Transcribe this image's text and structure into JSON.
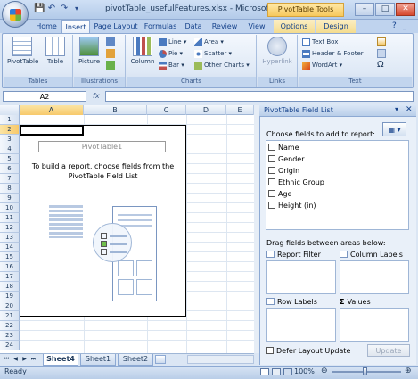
{
  "window": {
    "title": "pivotTable_usefulFeatures.xlsx - Microsoft Ex...",
    "context_title": "PivotTable Tools",
    "minimize": "–",
    "maximize": "□",
    "close": "✕"
  },
  "tabs": [
    "Home",
    "Insert",
    "Page Layout",
    "Formulas",
    "Data",
    "Review",
    "View",
    "Options",
    "Design"
  ],
  "ribbon": {
    "tables": {
      "label": "Tables",
      "pivot": "PivotTable",
      "table": "Table"
    },
    "illustrations": {
      "label": "Illustrations",
      "picture": "Picture"
    },
    "charts": {
      "label": "Charts",
      "column": "Column",
      "line": "Line",
      "pie": "Pie",
      "bar": "Bar",
      "area": "Area",
      "scatter": "Scatter",
      "other": "Other Charts"
    },
    "links": {
      "label": "Links",
      "hyperlink": "Hyperlink"
    },
    "text": {
      "label": "Text",
      "textbox": "Text Box",
      "header_footer": "Header & Footer",
      "wordart": "WordArt"
    }
  },
  "formula_bar": {
    "name_box": "A2",
    "fx": "fx",
    "value": ""
  },
  "grid": {
    "columns": [
      "A",
      "B",
      "C",
      "D",
      "E"
    ],
    "rows": [
      "1",
      "2",
      "3",
      "4",
      "5",
      "6",
      "7",
      "8",
      "9",
      "10",
      "11",
      "12",
      "13",
      "14",
      "15",
      "16",
      "17",
      "18",
      "19",
      "20",
      "21",
      "22",
      "23",
      "24"
    ],
    "pivot_name": "PivotTable1",
    "instruction_line1": "To build a report, choose fields from the",
    "instruction_line2": "PivotTable Field List"
  },
  "sheet_tabs": [
    "Sheet4",
    "Sheet1",
    "Sheet2"
  ],
  "status": {
    "ready": "Ready",
    "zoom": "100%"
  },
  "field_list": {
    "title": "PivotTable Field List",
    "choose_label": "Choose fields to add to report:",
    "fields": [
      "Name",
      "Gender",
      "Origin",
      "Ethnic Group",
      "Age",
      "Height (in)"
    ],
    "drag_label": "Drag fields between areas below:",
    "areas": {
      "report_filter": "Report Filter",
      "column_labels": "Column Labels",
      "row_labels": "Row Labels",
      "values": "Values"
    },
    "defer_label": "Defer Layout Update",
    "update_button": "Update"
  }
}
